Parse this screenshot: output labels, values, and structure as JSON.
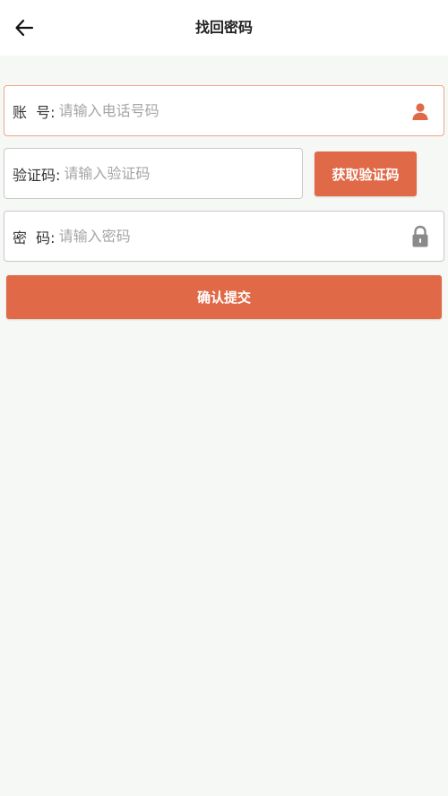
{
  "header": {
    "title": "找回密码",
    "back_icon": "arrow-left-icon"
  },
  "form": {
    "account": {
      "label": "账  号:",
      "placeholder": "请输入电话号码",
      "value": "",
      "icon": "user-icon"
    },
    "code": {
      "label": "验证码:",
      "placeholder": "请输入验证码",
      "value": ""
    },
    "get_code_label": "获取验证码",
    "password": {
      "label": "密  码:",
      "placeholder": "请输入密码",
      "value": "",
      "icon": "lock-icon"
    },
    "submit_label": "确认提交"
  },
  "colors": {
    "accent": "#e06a48",
    "background": "#f6f8f5",
    "active_border": "#f0a58c"
  }
}
